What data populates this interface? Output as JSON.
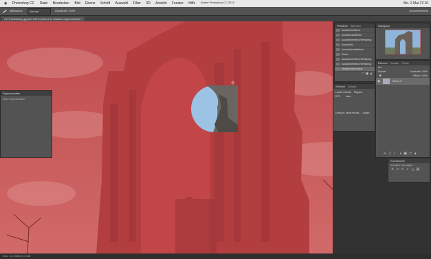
{
  "menubar": {
    "items": [
      "Photoshop CC",
      "Datei",
      "Bearbeiten",
      "Bild",
      "Ebene",
      "Schrift",
      "Auswahl",
      "Filter",
      "3D",
      "Ansicht",
      "Fenster",
      "Hilfe"
    ],
    "clock": "Mo. 2 Mai 17:10",
    "app_title": "Adobe Photoshop CC 2015"
  },
  "optionsbar": {
    "tool_label": "Malmodus",
    "mode_value": "Normal",
    "opacity_label": "Deckkraft: 100%",
    "workspace": "Grundelemente"
  },
  "tab": {
    "title": "2179 Abbildung.jpg bei 100% (Ebene 0, Maskierungsmodus/8) *"
  },
  "panels": {
    "protocol": {
      "tabs": [
        "Protokoll",
        "Aktionen"
      ],
      "rows": [
        "Auswahlrechteck",
        "Auswahl aufheben",
        "Auswahlrechteck Werkzeug",
        "Ausschnitt",
        "Ausschnitt aufheben",
        "Pinsel",
        "Auswahlrechteck Werkzeug",
        "Auswahlrechteck Werkzeug",
        "Maskierungsmodus"
      ]
    },
    "navigator": {
      "tabs": [
        "Navigator"
      ],
      "zoom": "100%"
    },
    "layers": {
      "tabs": [
        "Ebenen",
        "Kanäle",
        "Pfade"
      ],
      "filter_label": "Art",
      "blend": "Normal",
      "opacity": "Deckkraft: 100%",
      "fill": "Fläche: 100%",
      "layer_name": "Ebene 0"
    },
    "properties": {
      "title": "Eigenschaften",
      "empty_text": "Keine Eigenschaften"
    },
    "character": {
      "tabs": [
        "Zeichen",
        "Absatz"
      ],
      "font": "Lucida Grande",
      "style": "Regular",
      "size": "8 Pt",
      "leading": "Auto",
      "lang": "Deutsch: neue Rechts.",
      "aa": "Scharf"
    },
    "adjustments": {
      "title": "Korrekturen",
      "subtitle": "Korrektur hinzufügen"
    }
  },
  "status": {
    "text": "Dok: 14,4 MB/22,1 MB"
  },
  "colors": {
    "mask_red": "#c94a4a",
    "sky": "#9cc3e3",
    "stone": "#6a6560"
  }
}
